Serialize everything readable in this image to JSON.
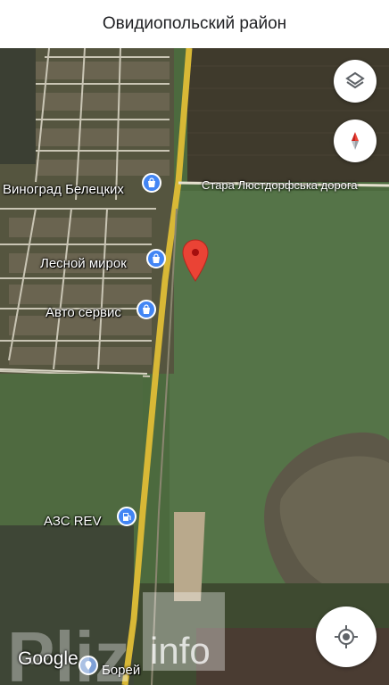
{
  "header": {
    "title": "Овидиопольский район"
  },
  "map": {
    "road_label": "Стара Люстдорфська дорога",
    "pois": [
      {
        "name": "Виноград Белецких",
        "icon": "shopping-bag-icon"
      },
      {
        "name": "Лесной мирок",
        "icon": "shopping-bag-icon"
      },
      {
        "name": "Авто сервис",
        "icon": "shopping-bag-icon"
      },
      {
        "name": "АЗС REV",
        "icon": "gas-station-icon"
      },
      {
        "name": "Борей",
        "icon": "place-icon"
      }
    ],
    "attribution": "Google",
    "watermark_text_1": "Pliz",
    "watermark_text_2": "info"
  },
  "controls": {
    "layers": "layers-icon",
    "compass": "compass-icon",
    "location": "my-location-icon"
  },
  "colors": {
    "road": "#d8b836",
    "poi_blue": "#4285f4",
    "pin_red": "#ea4335",
    "field": "#4c6a3e"
  }
}
